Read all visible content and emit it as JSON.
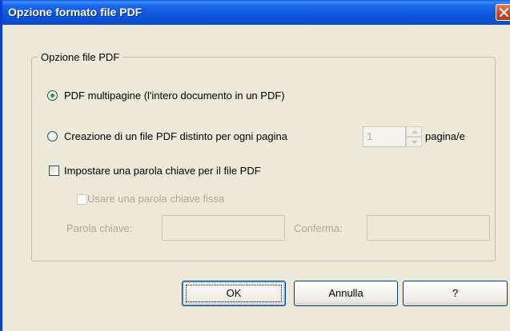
{
  "window": {
    "title": "Opzione formato file PDF",
    "close_icon": "close-icon"
  },
  "group": {
    "legend": "Opzione file PDF"
  },
  "options": {
    "multipage_label": "PDF multipagine (l'intero documento in un PDF)",
    "multipage_selected": true,
    "perpage_label": "Creazione di un file PDF distinto per ogni pagina",
    "perpage_selected": false,
    "pages_value": "1",
    "pages_suffix": "pagina/e",
    "password_label": "Impostare una parola chiave per il file PDF",
    "password_checked": false,
    "fixed_password_label": "Usare una parola chiave fissa",
    "fixed_password_checked": false,
    "password_field_label": "Parola chiave:",
    "password_value": "",
    "confirm_field_label": "Conferma:",
    "confirm_value": ""
  },
  "buttons": {
    "ok": "OK",
    "cancel": "Annulla",
    "help": "?"
  },
  "colors": {
    "titlebar": "#0a4fd0",
    "dialog_bg": "#ece9d8",
    "disabled_text": "#aca899",
    "close_button": "#c9431c",
    "radio_dot": "#21a121"
  }
}
